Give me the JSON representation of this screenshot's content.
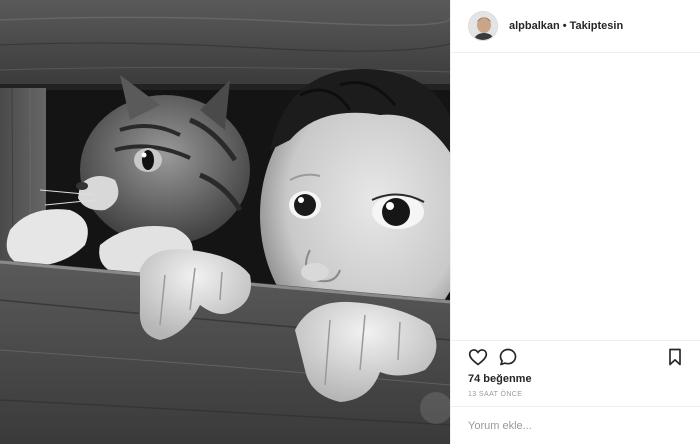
{
  "header": {
    "username": "alpbalkan",
    "separator": "•",
    "follow_status": "Takiptesin",
    "avatar_icon": "user-avatar-icon"
  },
  "actions": {
    "like_icon": "heart-icon",
    "comment_icon": "speech-bubble-icon",
    "save_icon": "bookmark-icon"
  },
  "post": {
    "likes": "74 beğenme",
    "timestamp": "13 SAAT ÖNCE",
    "photo_description_icon": "kitten-and-child-photo"
  },
  "comment_box": {
    "placeholder": "Yorum ekle..."
  },
  "colors": {
    "border": "#efefef",
    "text": "#262626",
    "muted": "#999999"
  }
}
